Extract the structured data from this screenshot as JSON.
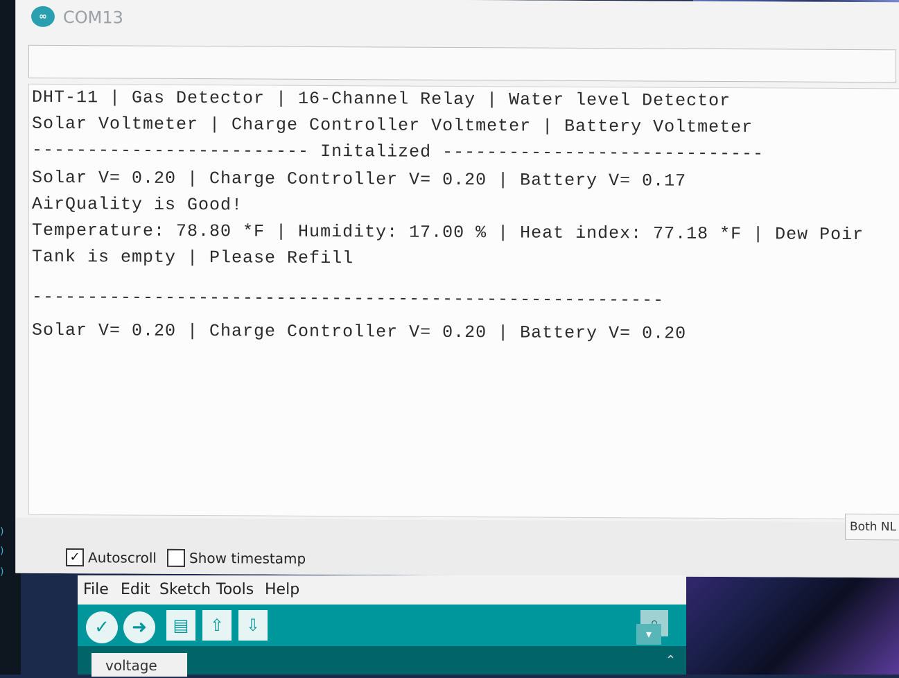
{
  "window": {
    "title": "COM13"
  },
  "send": {
    "value": ""
  },
  "output_lines": [
    "DHT-11 | Gas Detector | 16-Channel Relay | Water level Detector",
    "Solar Voltmeter | Charge Controller Voltmeter | Battery Voltmeter",
    "------------------------- Initalized -----------------------------",
    "Solar V= 0.20 | Charge Controller V= 0.20 | Battery V= 0.17",
    "AirQuality is Good!",
    "Temperature: 78.80 *F | Humidity: 17.00 % | Heat index: 77.18 *F | Dew Poir",
    "Tank is empty | Please Refill",
    "",
    "---------------------------------------------------------",
    "Solar V= 0.20 | Charge Controller V= 0.20 | Battery V= 0.20"
  ],
  "footer": {
    "autoscroll_label": "Autoscroll",
    "autoscroll_checked": true,
    "timestamp_label": "Show timestamp",
    "timestamp_checked": false,
    "line_ending": "Both NL &"
  },
  "ide": {
    "menu": [
      "File",
      "Edit",
      "Sketch",
      "Tools",
      "Help"
    ],
    "tab_label": "voltage"
  }
}
